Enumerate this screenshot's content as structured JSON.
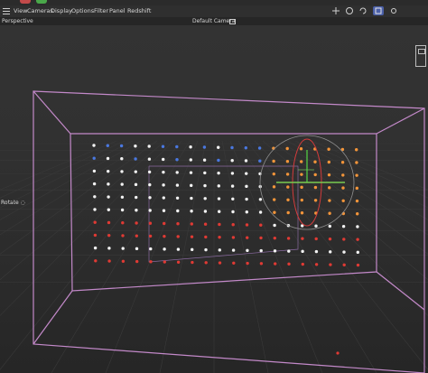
{
  "menubar": {
    "items": [
      "View",
      "Cameras",
      "Display",
      "Options",
      "Filter",
      "Panel",
      "Redshift"
    ]
  },
  "header": {
    "view_mode": "Perspective",
    "camera": "Default Camera"
  },
  "viewport": {
    "tool_status": "Rotate",
    "colors": {
      "cage": "#c389c9",
      "blue": "#4a78e0",
      "white": "#f2f2f2",
      "orange": "#f3953a",
      "red": "#e03a34",
      "gizmo_y": "#4fbe42",
      "gizmo_x": "#7acb50",
      "gizmo_ring": "#d23b3b"
    }
  },
  "toolbar_right": {
    "icons": [
      "move-tool-icon",
      "scale-tool-icon",
      "rotate-tool-icon",
      "render-view-icon",
      "settings-icon"
    ]
  }
}
